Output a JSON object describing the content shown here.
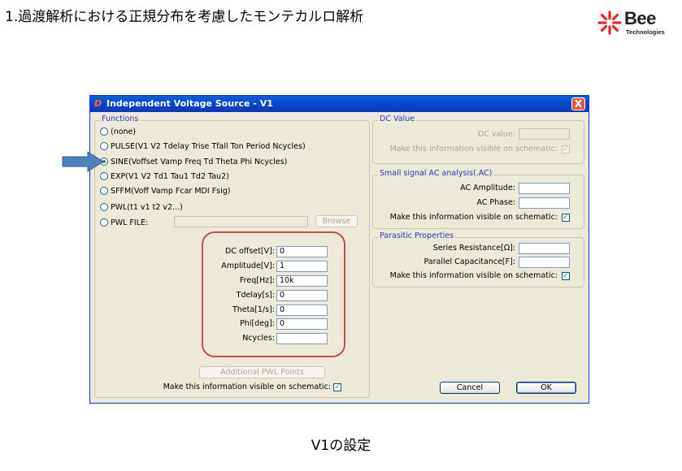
{
  "slide": {
    "title": "1.過渡解析における正規分布を考慮したモンテカルロ解析",
    "caption": "V1の設定",
    "logo": {
      "name": "Bee",
      "sub": "Technologies"
    }
  },
  "dialog": {
    "title": "Independent Voltage Source - V1",
    "close_label": "X",
    "functions": {
      "label": "Functions",
      "options": [
        {
          "label": "(none)",
          "checked": false
        },
        {
          "label": "PULSE(V1 V2 Tdelay Trise Tfall Ton Period Ncycles)",
          "checked": false
        },
        {
          "label": "SINE(Voffset Vamp Freq Td Theta Phi Ncycles)",
          "checked": true
        },
        {
          "label": "EXP(V1 V2 Td1 Tau1 Td2 Tau2)",
          "checked": false
        },
        {
          "label": "SFFM(Voff Vamp Fcar MDI Fsig)",
          "checked": false
        },
        {
          "label": "PWL(t1 v1 t2 v2...)",
          "checked": false
        },
        {
          "label": "PWL FILE:",
          "checked": false
        }
      ],
      "pwl_file_value": "",
      "browse_label": "Browse"
    },
    "sine_params": [
      {
        "label": "DC offset[V]:",
        "value": "0"
      },
      {
        "label": "Amplitude[V]:",
        "value": "1"
      },
      {
        "label": "Freq[Hz]:",
        "value": "10k"
      },
      {
        "label": "Tdelay[s]:",
        "value": "0"
      },
      {
        "label": "Theta[1/s]:",
        "value": "0"
      },
      {
        "label": "Phi[deg]:",
        "value": "0"
      },
      {
        "label": "Ncycles:",
        "value": ""
      }
    ],
    "additional_pwl_label": "Additional PWL Points",
    "visible_left_label": "Make this information visible on schematic:",
    "visible_left_checked": true,
    "dc_value": {
      "label": "DC Value",
      "field_label": "DC value:",
      "value": "",
      "visible_label": "Make this information visible on schematic:",
      "checked": true
    },
    "ac": {
      "label": "Small signal AC analysis(.AC)",
      "amplitude_label": "AC Amplitude:",
      "amplitude_value": "",
      "phase_label": "AC Phase:",
      "phase_value": "",
      "visible_label": "Make this information visible on schematic:",
      "checked": true
    },
    "parasitic": {
      "label": "Parasitic Properties",
      "series_label": "Series Resistance[Ω]:",
      "series_value": "",
      "parallel_label": "Parallel Capacitance[F]:",
      "parallel_value": "",
      "visible_label": "Make this information visible on schematic:",
      "checked": true
    },
    "cancel_label": "Cancel",
    "ok_label": "OK"
  },
  "colors": {
    "highlight": "#c0504d",
    "arrow": "#4f81bd",
    "titlebar": "#0842c8",
    "dialog_bg": "#ece9d8"
  }
}
